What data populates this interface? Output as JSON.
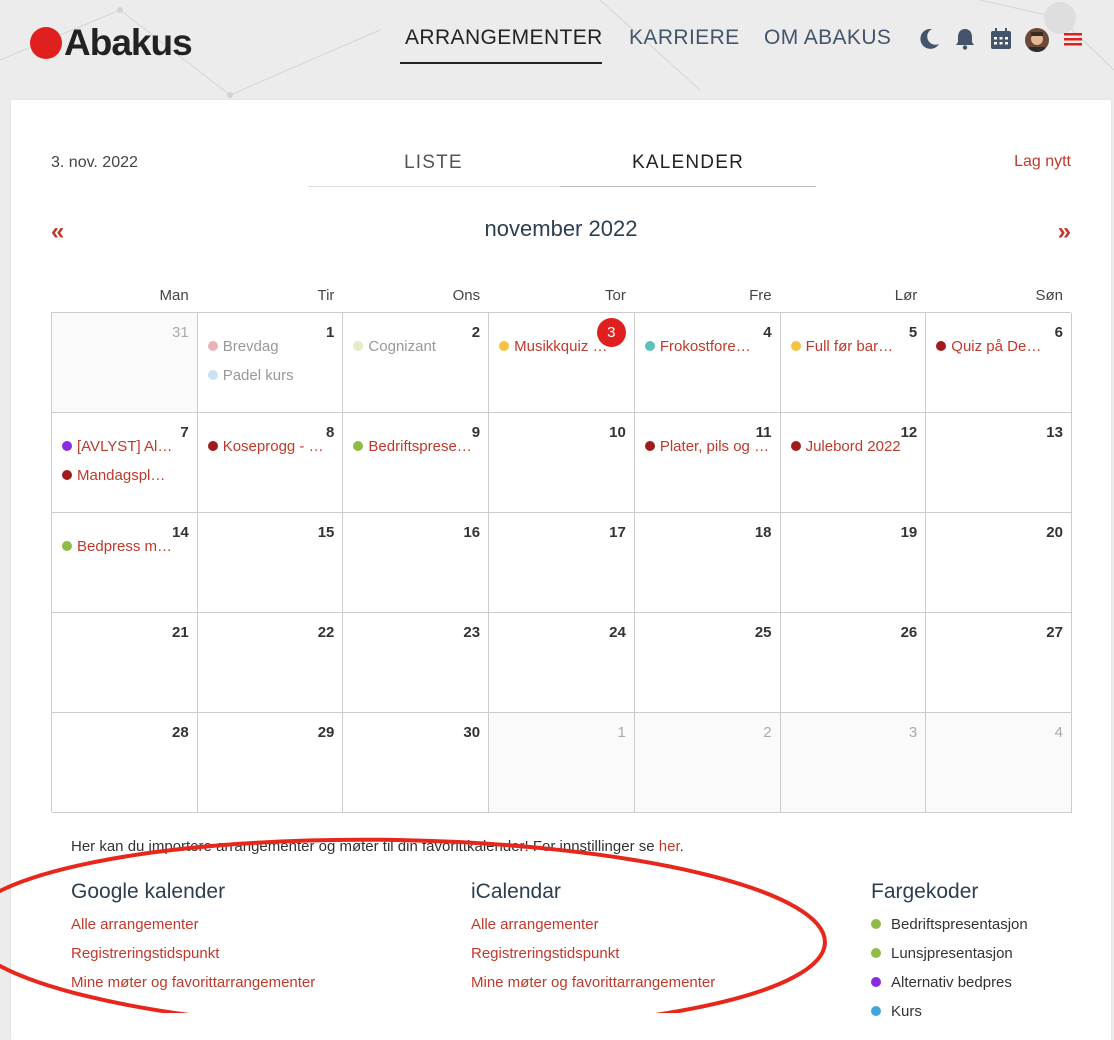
{
  "brand": {
    "name": "Abakus"
  },
  "nav": {
    "items": [
      "ARRANGEMENTER",
      "KARRIERE",
      "OM ABAKUS"
    ],
    "active": "ARRANGEMENTER"
  },
  "header_icons": [
    "moon-icon",
    "bell-icon",
    "calendar-icon",
    "avatar",
    "menu-icon"
  ],
  "page": {
    "current_date": "3. nov. 2022",
    "tabs": [
      "LISTE",
      "KALENDER"
    ],
    "active_tab": "KALENDER",
    "create_label": "Lag nytt",
    "prev_label": "«",
    "next_label": "»",
    "month_title": "november 2022"
  },
  "weekdays": [
    "Man",
    "Tir",
    "Ons",
    "Tor",
    "Fre",
    "Lør",
    "Søn"
  ],
  "calendar": {
    "weeks": [
      [
        {
          "day": "31",
          "other": true,
          "events": []
        },
        {
          "day": "1",
          "events": [
            {
              "title": "Brevdag",
              "color": "#e8b4b8",
              "faded": true
            },
            {
              "title": "Padel kurs",
              "color": "#c9e2f7",
              "faded": true
            }
          ]
        },
        {
          "day": "2",
          "events": [
            {
              "title": "Cognizant",
              "color": "#e4ecc7",
              "faded": true
            }
          ]
        },
        {
          "day": "3",
          "today": true,
          "events": [
            {
              "title": "Musikkquiz m…",
              "color": "#f5c242"
            }
          ]
        },
        {
          "day": "4",
          "events": [
            {
              "title": "Frokostforedr…",
              "color": "#5bc0be"
            }
          ]
        },
        {
          "day": "5",
          "events": [
            {
              "title": "Full før barne…",
              "color": "#f5c242"
            }
          ]
        },
        {
          "day": "6",
          "events": [
            {
              "title": "Quiz på Den …",
              "color": "#a01c1c"
            }
          ]
        }
      ],
      [
        {
          "day": "7",
          "events": [
            {
              "title": "[AVLYST] Alte…",
              "color": "#8a2be2"
            },
            {
              "title": "Mandagsplas…",
              "color": "#a01c1c"
            }
          ]
        },
        {
          "day": "8",
          "events": [
            {
              "title": "Koseprogg - …",
              "color": "#a01c1c"
            }
          ]
        },
        {
          "day": "9",
          "events": [
            {
              "title": "Bedriftsprese…",
              "color": "#8fbc45"
            }
          ]
        },
        {
          "day": "10",
          "events": []
        },
        {
          "day": "11",
          "events": [
            {
              "title": "Plater, pils og …",
              "color": "#a01c1c"
            }
          ]
        },
        {
          "day": "12",
          "events": [
            {
              "title": "Julebord 2022",
              "color": "#a01c1c"
            }
          ]
        },
        {
          "day": "13",
          "events": []
        }
      ],
      [
        {
          "day": "14",
          "events": [
            {
              "title": "Bedpress me…",
              "color": "#8fbc45"
            }
          ]
        },
        {
          "day": "15",
          "events": []
        },
        {
          "day": "16",
          "events": []
        },
        {
          "day": "17",
          "events": []
        },
        {
          "day": "18",
          "events": []
        },
        {
          "day": "19",
          "events": []
        },
        {
          "day": "20",
          "events": []
        }
      ],
      [
        {
          "day": "21",
          "events": []
        },
        {
          "day": "22",
          "events": []
        },
        {
          "day": "23",
          "events": []
        },
        {
          "day": "24",
          "events": []
        },
        {
          "day": "25",
          "events": []
        },
        {
          "day": "26",
          "events": []
        },
        {
          "day": "27",
          "events": []
        }
      ],
      [
        {
          "day": "28",
          "events": []
        },
        {
          "day": "29",
          "events": []
        },
        {
          "day": "30",
          "events": []
        },
        {
          "day": "1",
          "other": true,
          "events": []
        },
        {
          "day": "2",
          "other": true,
          "events": []
        },
        {
          "day": "3",
          "other": true,
          "events": []
        },
        {
          "day": "4",
          "other": true,
          "events": []
        }
      ]
    ]
  },
  "import": {
    "intro_text": "Her kan du importere arrangementer og møter til din favorittkalender! For innstillinger se ",
    "intro_link": "her",
    "intro_end": ".",
    "google": {
      "title": "Google kalender",
      "links": [
        "Alle arrangementer",
        "Registreringstidspunkt",
        "Mine møter og favorittarrangementer"
      ]
    },
    "ical": {
      "title": "iCalendar",
      "links": [
        "Alle arrangementer",
        "Registreringstidspunkt",
        "Mine møter og favorittarrangementer"
      ]
    },
    "legend": {
      "title": "Fargekoder",
      "items": [
        {
          "label": "Bedriftspresentasjon",
          "color": "#8fbc45"
        },
        {
          "label": "Lunsjpresentasjon",
          "color": "#8fbc45"
        },
        {
          "label": "Alternativ bedpres",
          "color": "#8a2be2"
        },
        {
          "label": "Kurs",
          "color": "#3fa7e0"
        }
      ]
    }
  },
  "colors": {
    "accent": "#c0392b",
    "brand_red": "#e0201f",
    "annotation": "#e8271c"
  }
}
